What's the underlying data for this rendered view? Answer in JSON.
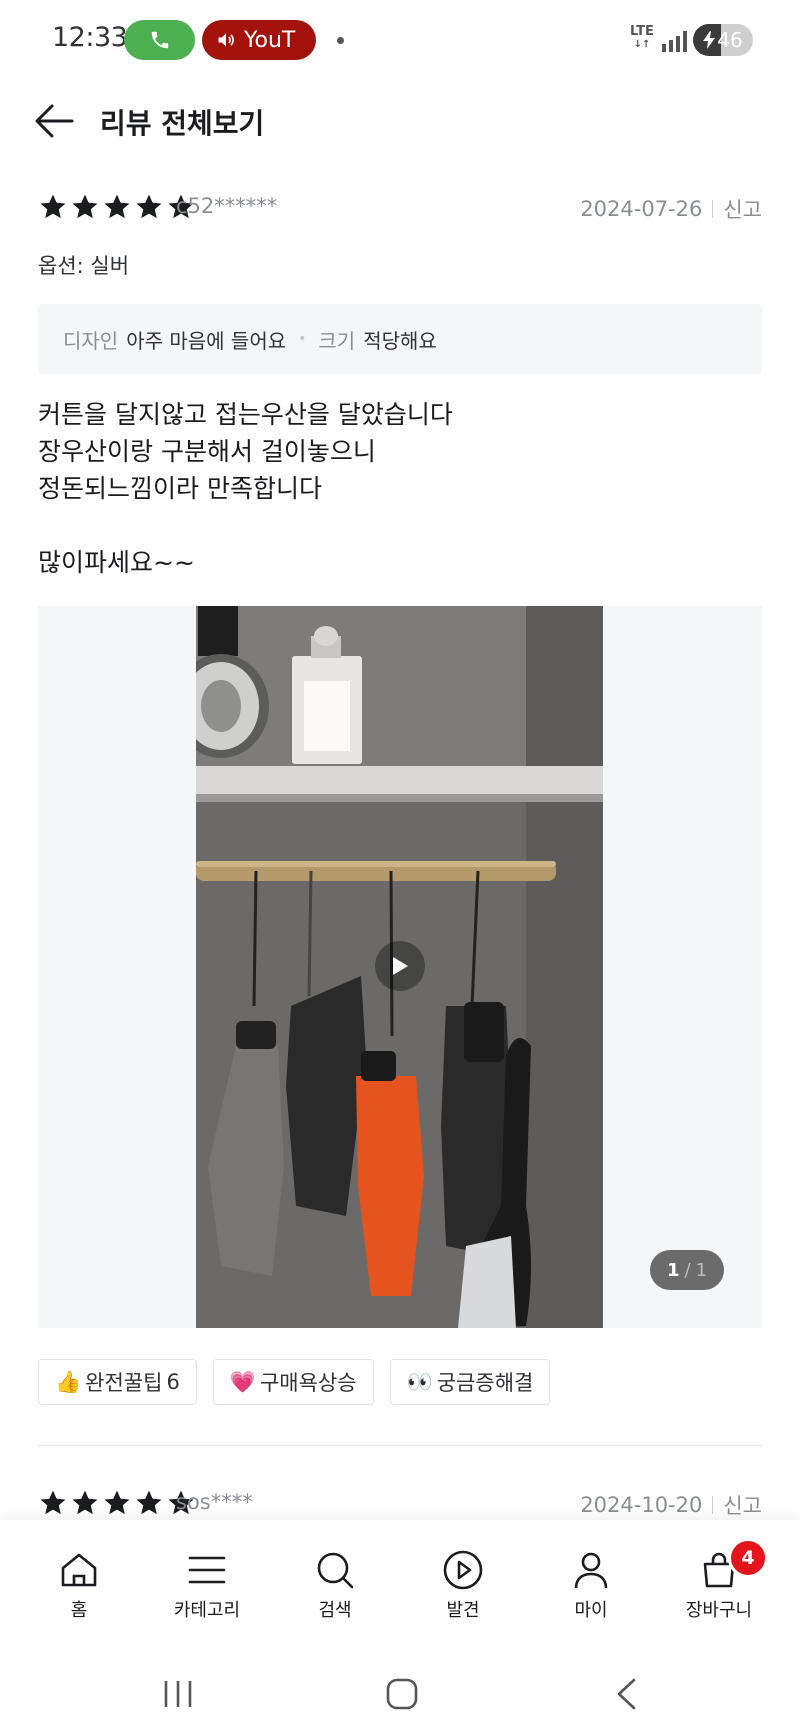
{
  "status_bar": {
    "time": "12:33",
    "youtube_label": "YouT",
    "network": "LTE",
    "battery": "46",
    "battery_level": 0.46,
    "icons": [
      "phone-icon",
      "speaker-icon",
      "signal-icon",
      "battery-icon"
    ]
  },
  "header": {
    "title": "리뷰 전체보기",
    "back_icon": "arrow-left-icon"
  },
  "reviews": [
    {
      "rating": 5,
      "reviewer": "c52******",
      "date": "2024-07-26",
      "report": "신고",
      "option": "옵션: 실버",
      "attributes": [
        {
          "key": "디자인",
          "value": "아주 마음에 들어요"
        },
        {
          "key": "크기",
          "value": "적당해요"
        }
      ],
      "text_lines": [
        "커튼을 달지않고 접는우산을 달았습니다",
        "장우산이랑 구분해서 걸이놓으니",
        "정돈되느낌이라 만족합니다",
        "",
        "많이파세요~~"
      ],
      "media": {
        "type": "video",
        "current": "1",
        "total": "1",
        "separator": "/"
      },
      "reactions": [
        {
          "emoji": "👍",
          "label": "완전꿀팁",
          "count": "6"
        },
        {
          "emoji": "💗",
          "label": "구매욕상승",
          "count": ""
        },
        {
          "emoji": "👀",
          "label": "궁금증해결",
          "count": ""
        }
      ]
    },
    {
      "rating": 5,
      "reviewer": "sos****",
      "date": "2024-10-20",
      "report": "신고"
    }
  ],
  "bottom_nav": {
    "items": [
      {
        "label": "홈",
        "icon": "home-icon"
      },
      {
        "label": "카테고리",
        "icon": "menu-icon"
      },
      {
        "label": "검색",
        "icon": "search-icon"
      },
      {
        "label": "발견",
        "icon": "play-circle-icon"
      },
      {
        "label": "마이",
        "icon": "user-icon"
      },
      {
        "label": "장바구니",
        "icon": "shopping-bag-icon"
      }
    ],
    "cart_count": "4"
  },
  "colors": {
    "accent_red": "#e4141c",
    "call_green": "#4caf50",
    "youtube_red": "#a4120c",
    "star": "#1b1c1f",
    "muted_text": "#8a8d93"
  }
}
